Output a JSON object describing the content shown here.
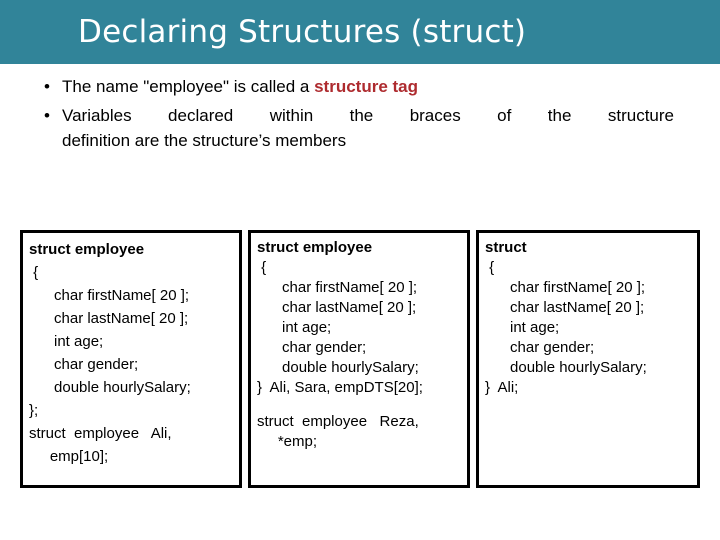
{
  "slide": {
    "title": "Declaring Structures (struct)"
  },
  "bullets": [
    {
      "marker": "•",
      "parts": [
        {
          "text": "The name \"employee\" is called a ",
          "style": "normal"
        },
        {
          "text": "structure tag",
          "style": "red-bold"
        }
      ]
    },
    {
      "marker": "•",
      "line1": "Variables declared within the braces of the structure",
      "line2": "definition are the structure’s members"
    }
  ],
  "code_boxes": [
    {
      "id": "box-declaration-with-tag",
      "lines": [
        {
          "text": "struct employee",
          "bold": true
        },
        {
          "text": " {",
          "bold": false
        },
        {
          "text": "      char firstName[ 20 ];",
          "bold": false
        },
        {
          "text": "      char lastName[ 20 ];",
          "bold": false
        },
        {
          "text": "      int age;",
          "bold": false
        },
        {
          "text": "      char gender;",
          "bold": false
        },
        {
          "text": "      double hourlySalary;",
          "bold": false
        },
        {
          "text": "};",
          "bold": false
        },
        {
          "text": "struct  employee   Ali,",
          "bold": false
        },
        {
          "text": "     emp[10];",
          "bold": false
        }
      ]
    },
    {
      "id": "box-declaration-with-inline-vars",
      "lines": [
        {
          "text": "struct employee",
          "bold": true
        },
        {
          "text": " {",
          "bold": false
        },
        {
          "text": "      char firstName[ 20 ];",
          "bold": false
        },
        {
          "text": "      char lastName[ 20 ];",
          "bold": false
        },
        {
          "text": "      int age;",
          "bold": false
        },
        {
          "text": "      char gender;",
          "bold": false
        },
        {
          "text": "      double hourlySalary;",
          "bold": false
        },
        {
          "text": "}  Ali, Sara, empDTS[20];",
          "bold": false
        },
        {
          "text": "",
          "bold": false,
          "spacer": true
        },
        {
          "text": "struct  employee   Reza,",
          "bold": false
        },
        {
          "text": "     *emp;",
          "bold": false
        }
      ]
    },
    {
      "id": "box-anonymous-struct",
      "lines": [
        {
          "text": "struct",
          "bold": true
        },
        {
          "text": " {",
          "bold": false
        },
        {
          "text": "      char firstName[ 20 ];",
          "bold": false
        },
        {
          "text": "      char lastName[ 20 ];",
          "bold": false
        },
        {
          "text": "      int age;",
          "bold": false
        },
        {
          "text": "      char gender;",
          "bold": false
        },
        {
          "text": "      double hourlySalary;",
          "bold": false
        },
        {
          "text": "}  Ali;",
          "bold": false
        }
      ]
    }
  ],
  "colors": {
    "banner": "#318499",
    "banner_text": "#ffffff",
    "tag_red": "#AE2B2F",
    "body_text": "#000000",
    "box_border": "#000000",
    "page_background": "#ffffff"
  }
}
